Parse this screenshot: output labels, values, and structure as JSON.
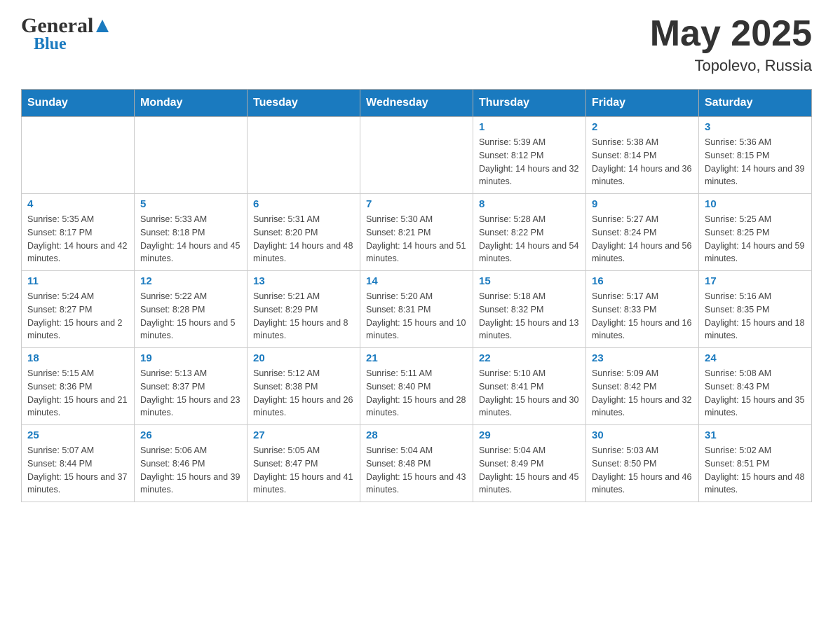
{
  "header": {
    "logo_general": "General",
    "logo_blue": "Blue",
    "month": "May 2025",
    "location": "Topolevo, Russia"
  },
  "days_of_week": [
    "Sunday",
    "Monday",
    "Tuesday",
    "Wednesday",
    "Thursday",
    "Friday",
    "Saturday"
  ],
  "weeks": [
    [
      {
        "day": "",
        "info": ""
      },
      {
        "day": "",
        "info": ""
      },
      {
        "day": "",
        "info": ""
      },
      {
        "day": "",
        "info": ""
      },
      {
        "day": "1",
        "info": "Sunrise: 5:39 AM\nSunset: 8:12 PM\nDaylight: 14 hours and 32 minutes."
      },
      {
        "day": "2",
        "info": "Sunrise: 5:38 AM\nSunset: 8:14 PM\nDaylight: 14 hours and 36 minutes."
      },
      {
        "day": "3",
        "info": "Sunrise: 5:36 AM\nSunset: 8:15 PM\nDaylight: 14 hours and 39 minutes."
      }
    ],
    [
      {
        "day": "4",
        "info": "Sunrise: 5:35 AM\nSunset: 8:17 PM\nDaylight: 14 hours and 42 minutes."
      },
      {
        "day": "5",
        "info": "Sunrise: 5:33 AM\nSunset: 8:18 PM\nDaylight: 14 hours and 45 minutes."
      },
      {
        "day": "6",
        "info": "Sunrise: 5:31 AM\nSunset: 8:20 PM\nDaylight: 14 hours and 48 minutes."
      },
      {
        "day": "7",
        "info": "Sunrise: 5:30 AM\nSunset: 8:21 PM\nDaylight: 14 hours and 51 minutes."
      },
      {
        "day": "8",
        "info": "Sunrise: 5:28 AM\nSunset: 8:22 PM\nDaylight: 14 hours and 54 minutes."
      },
      {
        "day": "9",
        "info": "Sunrise: 5:27 AM\nSunset: 8:24 PM\nDaylight: 14 hours and 56 minutes."
      },
      {
        "day": "10",
        "info": "Sunrise: 5:25 AM\nSunset: 8:25 PM\nDaylight: 14 hours and 59 minutes."
      }
    ],
    [
      {
        "day": "11",
        "info": "Sunrise: 5:24 AM\nSunset: 8:27 PM\nDaylight: 15 hours and 2 minutes."
      },
      {
        "day": "12",
        "info": "Sunrise: 5:22 AM\nSunset: 8:28 PM\nDaylight: 15 hours and 5 minutes."
      },
      {
        "day": "13",
        "info": "Sunrise: 5:21 AM\nSunset: 8:29 PM\nDaylight: 15 hours and 8 minutes."
      },
      {
        "day": "14",
        "info": "Sunrise: 5:20 AM\nSunset: 8:31 PM\nDaylight: 15 hours and 10 minutes."
      },
      {
        "day": "15",
        "info": "Sunrise: 5:18 AM\nSunset: 8:32 PM\nDaylight: 15 hours and 13 minutes."
      },
      {
        "day": "16",
        "info": "Sunrise: 5:17 AM\nSunset: 8:33 PM\nDaylight: 15 hours and 16 minutes."
      },
      {
        "day": "17",
        "info": "Sunrise: 5:16 AM\nSunset: 8:35 PM\nDaylight: 15 hours and 18 minutes."
      }
    ],
    [
      {
        "day": "18",
        "info": "Sunrise: 5:15 AM\nSunset: 8:36 PM\nDaylight: 15 hours and 21 minutes."
      },
      {
        "day": "19",
        "info": "Sunrise: 5:13 AM\nSunset: 8:37 PM\nDaylight: 15 hours and 23 minutes."
      },
      {
        "day": "20",
        "info": "Sunrise: 5:12 AM\nSunset: 8:38 PM\nDaylight: 15 hours and 26 minutes."
      },
      {
        "day": "21",
        "info": "Sunrise: 5:11 AM\nSunset: 8:40 PM\nDaylight: 15 hours and 28 minutes."
      },
      {
        "day": "22",
        "info": "Sunrise: 5:10 AM\nSunset: 8:41 PM\nDaylight: 15 hours and 30 minutes."
      },
      {
        "day": "23",
        "info": "Sunrise: 5:09 AM\nSunset: 8:42 PM\nDaylight: 15 hours and 32 minutes."
      },
      {
        "day": "24",
        "info": "Sunrise: 5:08 AM\nSunset: 8:43 PM\nDaylight: 15 hours and 35 minutes."
      }
    ],
    [
      {
        "day": "25",
        "info": "Sunrise: 5:07 AM\nSunset: 8:44 PM\nDaylight: 15 hours and 37 minutes."
      },
      {
        "day": "26",
        "info": "Sunrise: 5:06 AM\nSunset: 8:46 PM\nDaylight: 15 hours and 39 minutes."
      },
      {
        "day": "27",
        "info": "Sunrise: 5:05 AM\nSunset: 8:47 PM\nDaylight: 15 hours and 41 minutes."
      },
      {
        "day": "28",
        "info": "Sunrise: 5:04 AM\nSunset: 8:48 PM\nDaylight: 15 hours and 43 minutes."
      },
      {
        "day": "29",
        "info": "Sunrise: 5:04 AM\nSunset: 8:49 PM\nDaylight: 15 hours and 45 minutes."
      },
      {
        "day": "30",
        "info": "Sunrise: 5:03 AM\nSunset: 8:50 PM\nDaylight: 15 hours and 46 minutes."
      },
      {
        "day": "31",
        "info": "Sunrise: 5:02 AM\nSunset: 8:51 PM\nDaylight: 15 hours and 48 minutes."
      }
    ]
  ]
}
